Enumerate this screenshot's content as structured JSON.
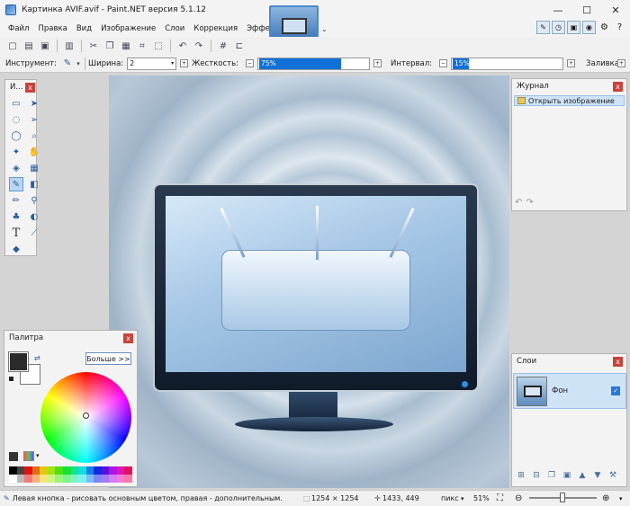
{
  "title": "Картинка AVIF.avif - Paint.NET версия 5.1.12",
  "menu": [
    "Файл",
    "Правка",
    "Вид",
    "Изображение",
    "Слои",
    "Коррекция",
    "Эффекты"
  ],
  "options": {
    "tool_label": "Инструмент:",
    "width_label": "Ширина:",
    "width_value": "2",
    "hardness_label": "Жесткость:",
    "hardness_value": "75%",
    "hardness_percent": 75,
    "interval_label": "Интервал:",
    "interval_value": "15%",
    "interval_percent": 15,
    "fill_label": "Заливка:"
  },
  "tools_panel": {
    "title": "И..."
  },
  "history_panel": {
    "title": "Журнал",
    "items": [
      "Открыть изображение"
    ]
  },
  "palette_panel": {
    "title": "Палитра",
    "more_button": "Больше >>",
    "primary_color": "#2b2b2b",
    "secondary_color": "#ffffff"
  },
  "layers_panel": {
    "title": "Слои",
    "layers": [
      {
        "name": "Фон",
        "visible": true
      }
    ]
  },
  "status": {
    "hint": "Левая кнопка - рисовать основным цветом, правая - дополнительным.",
    "image_size": "1254 × 1254",
    "cursor_pos": "1433, 449",
    "units": "пикс",
    "zoom": "51%"
  },
  "colors": {
    "accent": "#1070d8",
    "close": "#c9433a"
  }
}
